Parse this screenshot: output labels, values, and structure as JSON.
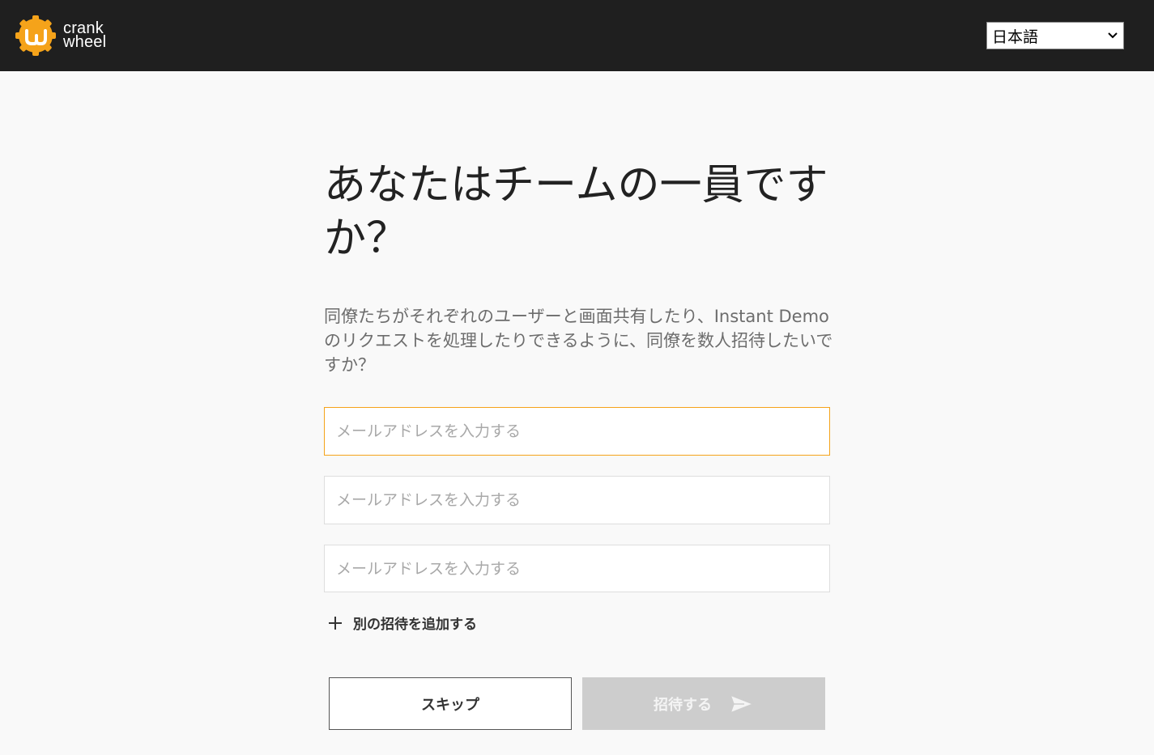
{
  "header": {
    "logo_line1": "crank",
    "logo_line2": "wheel",
    "language_selected": "日本語",
    "brand_color": "#f5a31a"
  },
  "main": {
    "heading": "あなたはチームの一員ですか？",
    "description": "同僚たちがそれぞれのユーザーと画面共有したり、Instant Demoのリクエストを処理したりできるように、同僚を数人招待したいですか？",
    "email_placeholder": "メールアドレスを入力する",
    "add_invite_label": "別の招待を追加する",
    "skip_label": "スキップ",
    "invite_label": "招待する"
  },
  "icons": {
    "logo": "crankwheel-logo-icon",
    "dropdown": "chevron-down-icon",
    "add": "plus-icon",
    "send": "send-icon"
  }
}
